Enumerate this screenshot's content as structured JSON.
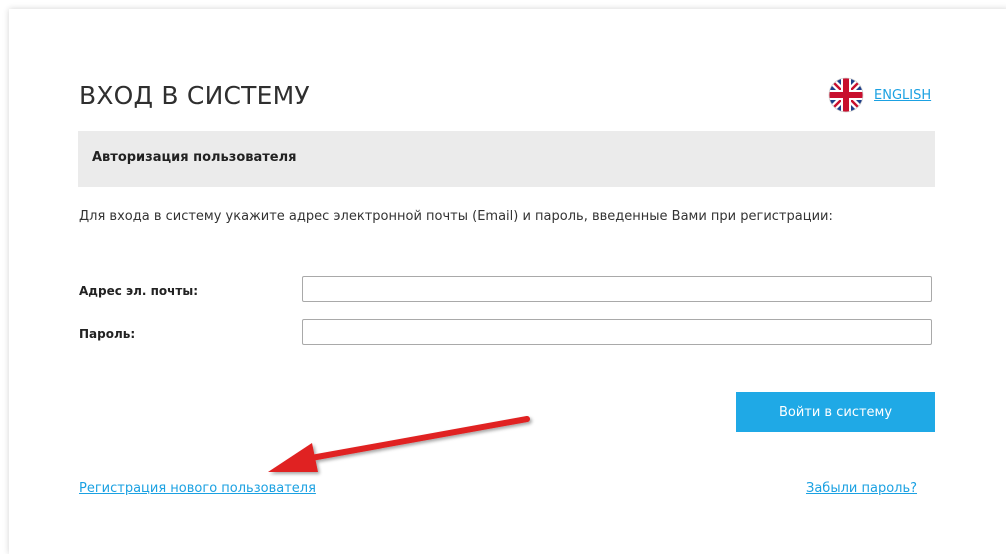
{
  "header": {
    "title": "ВХОД В СИСТЕМУ",
    "language_link": "ENGLISH",
    "language_icon": "uk-flag-icon"
  },
  "section": {
    "title": "Авторизация пользователя"
  },
  "instructions": "Для входа в систему укажите адрес электронной почты (Email) и пароль, введенные Вами при регистрации:",
  "form": {
    "email_label": "Адрес эл. почты:",
    "email_value": "",
    "password_label": "Пароль:",
    "password_value": "",
    "submit_label": "Войти в систему"
  },
  "links": {
    "register": "Регистрация нового пользователя",
    "forgot_password": "Забыли пароль?"
  },
  "colors": {
    "accent": "#1fa9e6",
    "link": "#1ba1e2",
    "section_bg": "#ebebeb",
    "annotation_arrow": "#e02020"
  }
}
